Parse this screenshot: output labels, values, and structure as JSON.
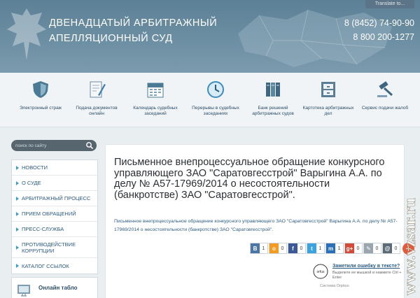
{
  "header": {
    "title_line1": "ДВЕНАДЦАТЫЙ АРБИТРАЖНЫЙ",
    "title_line2": "АПЕЛЛЯЦИОННЫЙ СУД",
    "phone1": "8 (8452) 74-90-90",
    "phone2": "8 800 200-1277",
    "translate_label": "Translate to..."
  },
  "nav": [
    {
      "label": "Электронный страж",
      "icon": "shield-icon"
    },
    {
      "label": "Подача документов онлайн",
      "icon": "document-pen-icon"
    },
    {
      "label": "Календарь судебных заседаний",
      "icon": "calendar-icon"
    },
    {
      "label": "Перерывы в судебных заседаниях",
      "icon": "clock-icon"
    },
    {
      "label": "Банк решений арбитражных судов",
      "icon": "books-icon"
    },
    {
      "label": "Картотека арбитражных дел",
      "icon": "file-cabinet-icon"
    },
    {
      "label": "Сервис подачи жалоб",
      "icon": "gavel-icon"
    }
  ],
  "sidebar": {
    "search_placeholder": "поиск по сайту",
    "menu": [
      {
        "label": "НОВОСТИ"
      },
      {
        "label": "О СУДЕ"
      },
      {
        "label": "АРБИТРАЖНЫЙ ПРОЦЕСС"
      },
      {
        "label": "ПРИЕМ ОБРАЩЕНИЙ"
      },
      {
        "label": "ПРЕСС-СЛУЖБА"
      },
      {
        "label": "ПРОТИВОДЕЙСТВИЕ КОРРУПЦИИ"
      },
      {
        "label": "КАТАЛОГ ССЫЛОК"
      }
    ],
    "online_label": "Онлайн табло"
  },
  "article": {
    "title": "Письменное внепроцессуальное обращение конкурсного управляющего ЗАО \"Саратовгесстрой\" Варыгина А.А. по делу № А57-17969/2014 о несостоятельности (банкротстве) ЗАО \"Саратовгесстрой\".",
    "body": "Письменное внепроцессуальное обращение конкурсного управляющего ЗАО \"Саратовгесстрой\" Варыгина А.А. по делу № А57-17969/2014 о несостоятельности (банкротстве) ЗАО \"Саратовгесстрой\"."
  },
  "share": [
    {
      "letter": "В",
      "count": "1",
      "color": "#4a76a8"
    },
    {
      "letter": "о",
      "count": "0",
      "color": "#f39a1f"
    },
    {
      "letter": "f",
      "count": "0",
      "color": "#3b5998"
    },
    {
      "letter": "t",
      "count": "1",
      "color": "#3aa3e0"
    },
    {
      "letter": "m",
      "count": "1",
      "color": "#2a6fb8"
    },
    {
      "letter": "g+",
      "count": "0",
      "color": "#d34b38"
    },
    {
      "letter": "✎",
      "count": "0",
      "color": "#9aa5ad"
    },
    {
      "letter": "@",
      "count": "0",
      "color": "#5b6a75"
    }
  ],
  "orfo": {
    "title": "Заметили ошибку в тексте?",
    "hint": "Выделите ее мышкой и нажмите Ctrl + Enter",
    "system": "Система Orphus"
  },
  "watermark": "www.vzsar.ru",
  "colors": {
    "header_bg": "#6e90a4",
    "link": "#2c5b83",
    "accent": "#3aa0c9"
  }
}
